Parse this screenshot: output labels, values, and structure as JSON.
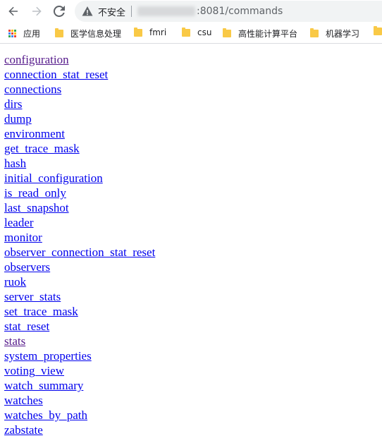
{
  "browser": {
    "security_label": "不安全",
    "url_rest": ":8081/commands"
  },
  "bookmarks": {
    "items": [
      {
        "label": "应用",
        "icon": "apps-grid-icon"
      },
      {
        "label": "医学信息处理",
        "icon": "folder-icon"
      },
      {
        "label": "fmri",
        "icon": "folder-icon"
      },
      {
        "label": "csu",
        "icon": "folder-icon"
      },
      {
        "label": "高性能计算平台",
        "icon": "folder-icon"
      },
      {
        "label": "机器学习",
        "icon": "folder-icon"
      }
    ]
  },
  "commands": [
    {
      "label": "configuration",
      "visited": true
    },
    {
      "label": "connection_stat_reset",
      "visited": false
    },
    {
      "label": "connections",
      "visited": false
    },
    {
      "label": "dirs",
      "visited": false
    },
    {
      "label": "dump",
      "visited": false
    },
    {
      "label": "environment",
      "visited": false
    },
    {
      "label": "get_trace_mask",
      "visited": false
    },
    {
      "label": "hash",
      "visited": false
    },
    {
      "label": "initial_configuration",
      "visited": false
    },
    {
      "label": "is_read_only",
      "visited": false
    },
    {
      "label": "last_snapshot",
      "visited": false
    },
    {
      "label": "leader",
      "visited": false
    },
    {
      "label": "monitor",
      "visited": false
    },
    {
      "label": "observer_connection_stat_reset",
      "visited": false
    },
    {
      "label": "observers",
      "visited": false
    },
    {
      "label": "ruok",
      "visited": false
    },
    {
      "label": "server_stats",
      "visited": false
    },
    {
      "label": "set_trace_mask",
      "visited": false
    },
    {
      "label": "stat_reset",
      "visited": false
    },
    {
      "label": "stats",
      "visited": true
    },
    {
      "label": "system_properties",
      "visited": false
    },
    {
      "label": "voting_view",
      "visited": false
    },
    {
      "label": "watch_summary",
      "visited": false
    },
    {
      "label": "watches",
      "visited": false
    },
    {
      "label": "watches_by_path",
      "visited": false
    },
    {
      "label": "zabstate",
      "visited": false
    }
  ],
  "colors": {
    "link": "#0000ee",
    "link_visited": "#551a8b",
    "omnibox_bg": "#f1f3f4",
    "folder": "#f9c946"
  }
}
